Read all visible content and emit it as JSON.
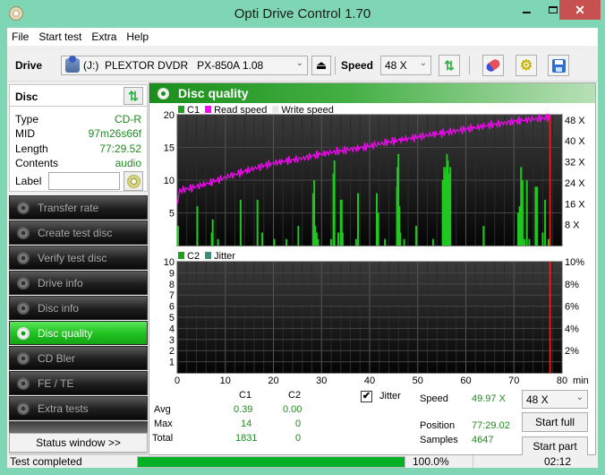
{
  "window": {
    "title": "Opti Drive Control 1.70",
    "controls": {
      "minimize": "minimize-icon",
      "maximize": "maximize-icon",
      "close": "✕"
    }
  },
  "menu": [
    "File",
    "Start test",
    "Extra",
    "Help"
  ],
  "toolbar": {
    "drive_label": "Drive",
    "drive_value": "(J:)  PLEXTOR DVDR   PX-850A 1.08",
    "speed_label": "Speed",
    "speed_value": "48 X",
    "eject_icon": "⏏",
    "icons": [
      "refresh-icon",
      "erase-icon",
      "settings-icon",
      "save-icon"
    ]
  },
  "disc": {
    "header": "Disc",
    "rows": [
      {
        "label": "Type",
        "value": "CD-R"
      },
      {
        "label": "MID",
        "value": "97m26s66f"
      },
      {
        "label": "Length",
        "value": "77:29.52"
      },
      {
        "label": "Contents",
        "value": "audio"
      }
    ],
    "label_field": {
      "label": "Label",
      "value": ""
    }
  },
  "nav": [
    {
      "label": "Transfer rate",
      "active": false
    },
    {
      "label": "Create test disc",
      "active": false
    },
    {
      "label": "Verify test disc",
      "active": false
    },
    {
      "label": "Drive info",
      "active": false
    },
    {
      "label": "Disc info",
      "active": false
    },
    {
      "label": "Disc quality",
      "active": true
    },
    {
      "label": "CD Bler",
      "active": false
    },
    {
      "label": "FE / TE",
      "active": false
    },
    {
      "label": "Extra tests",
      "active": false
    }
  ],
  "status_window_button": "Status window >>",
  "panel": {
    "title": "Disc quality"
  },
  "chart_data": [
    {
      "type": "bar",
      "title": "C1 / Read speed",
      "legend": [
        {
          "name": "C1",
          "color": "#1ea01e"
        },
        {
          "name": "Read speed",
          "color": "#ff00ff"
        },
        {
          "name": "Write speed",
          "color": "#e8e8e8"
        }
      ],
      "legend_placement": "top-left",
      "xlabel": "min",
      "xlim": [
        0,
        80
      ],
      "x_ticks": [
        0,
        10,
        20,
        30,
        40,
        50,
        60,
        70,
        80
      ],
      "ylim": [
        0,
        20
      ],
      "y_ticks": [
        5,
        10,
        15,
        20
      ],
      "y2_ticks": [
        "8 X",
        "16 X",
        "24 X",
        "32 X",
        "40 X",
        "48 X"
      ],
      "y2lim": [
        0,
        50
      ],
      "end_marker_min": 77.5,
      "series": [
        {
          "name": "C1",
          "x": [
            0,
            4,
            7,
            7.2,
            8.3,
            13,
            16.5,
            17.5,
            20,
            22.5,
            25,
            28.1,
            28.3,
            28.5,
            28.8,
            29.1,
            31.8,
            32.3,
            32.5,
            33.3,
            33.8,
            34,
            34.2,
            37,
            37.4,
            41.3,
            41.6,
            43,
            45.5,
            45.6,
            45.8,
            46,
            46.2,
            47,
            49.5,
            53,
            55,
            55.3,
            55.5,
            55.7,
            55.9,
            56.1,
            56.3,
            56.6,
            63.5,
            70.7,
            71,
            71.3,
            71.6,
            72,
            72.5,
            73,
            74.3,
            74.6,
            75.8,
            76.3,
            77
          ],
          "values": [
            3,
            6,
            2,
            4,
            1,
            7,
            7,
            2,
            1,
            1,
            3,
            8,
            10,
            3,
            2,
            1,
            1,
            11,
            13,
            2,
            7,
            7,
            2,
            1,
            8,
            8,
            5,
            1,
            9,
            12,
            14,
            6,
            2,
            1,
            3,
            1,
            10,
            12,
            11,
            12,
            14,
            13,
            11,
            12,
            3,
            5,
            6,
            12,
            10,
            1,
            10,
            1,
            9,
            9,
            2,
            7,
            1
          ]
        },
        {
          "name": "Read speed",
          "unit": "X",
          "x": [
            0,
            0.5,
            5,
            10,
            15,
            20,
            25,
            30,
            35,
            40,
            45,
            50,
            55,
            60,
            65,
            70,
            75,
            77.5
          ],
          "values": [
            16,
            21,
            23,
            26,
            29,
            31.5,
            33,
            35,
            36.5,
            38,
            40,
            41.5,
            43,
            44.5,
            46,
            47.5,
            48.5,
            49
          ]
        },
        {
          "name": "Write speed",
          "x": [],
          "values": []
        }
      ]
    },
    {
      "type": "bar",
      "title": "C2 / Jitter",
      "legend": [
        {
          "name": "C2",
          "color": "#1ea01e"
        },
        {
          "name": "Jitter",
          "color": "#3a8a80"
        }
      ],
      "legend_placement": "top-left",
      "xlabel": "min",
      "xlim": [
        0,
        80
      ],
      "x_ticks": [
        0,
        10,
        20,
        30,
        40,
        50,
        60,
        70,
        80
      ],
      "ylim": [
        0,
        10
      ],
      "y_ticks": [
        1,
        2,
        3,
        4,
        5,
        6,
        7,
        8,
        9,
        10
      ],
      "y2_ticks": [
        "2%",
        "4%",
        "6%",
        "8%",
        "10%"
      ],
      "y2lim": [
        0,
        10
      ],
      "end_marker_min": 77.5,
      "series": [
        {
          "name": "C2",
          "x": [],
          "values": []
        },
        {
          "name": "Jitter",
          "x": [],
          "values": []
        }
      ]
    }
  ],
  "stats": {
    "col_headers": [
      "C1",
      "C2"
    ],
    "rows": [
      {
        "label": "Avg",
        "c1": "0.39",
        "c2": "0.00"
      },
      {
        "label": "Max",
        "c1": "14",
        "c2": "0"
      },
      {
        "label": "Total",
        "c1": "1831",
        "c2": "0"
      }
    ],
    "jitter_checkbox": {
      "label": "Jitter",
      "checked": true,
      "mark": "✔"
    },
    "speed_label": "Speed",
    "speed_value": "49.97 X",
    "position_label": "Position",
    "position_value": "77:29.02",
    "samples_label": "Samples",
    "samples_value": "4647",
    "speed_select": "48 X",
    "start_full": "Start full",
    "start_part": "Start part"
  },
  "statusbar": {
    "text": "Test completed",
    "progress": 1.0,
    "progress_text": "100.0%",
    "elapsed": "02:12"
  }
}
